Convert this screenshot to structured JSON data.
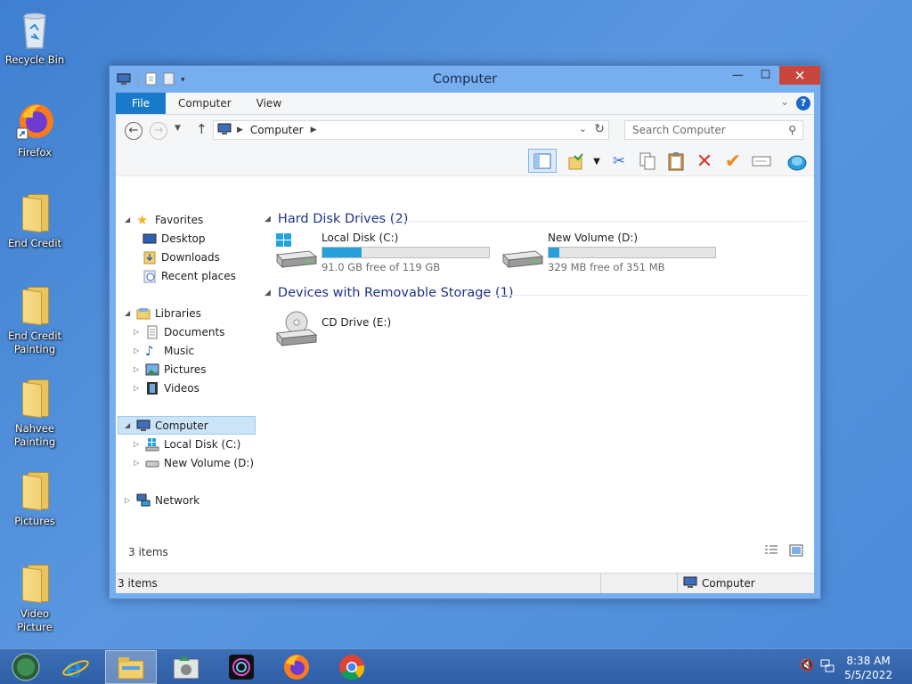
{
  "desktop": {
    "icons": [
      {
        "label": "Recycle Bin",
        "icon": "recycle-bin-icon"
      },
      {
        "label": "Firefox",
        "icon": "firefox-icon"
      },
      {
        "label": "End Credit",
        "icon": "folder-icon"
      },
      {
        "label": "End Credit Painting",
        "icon": "folder-icon"
      },
      {
        "label": "Nahvee Painting",
        "icon": "folder-icon"
      },
      {
        "label": "Pictures",
        "icon": "folder-icon"
      },
      {
        "label": "Video Picture",
        "icon": "folder-icon"
      }
    ]
  },
  "window": {
    "title": "Computer",
    "ribbon_tabs": [
      "File",
      "Computer",
      "View"
    ],
    "help": "?",
    "address": {
      "location": "Computer"
    },
    "search": {
      "placeholder": "Search Computer"
    },
    "nav_pane": {
      "favorites": {
        "label": "Favorites",
        "items": [
          "Desktop",
          "Downloads",
          "Recent places"
        ]
      },
      "libraries": {
        "label": "Libraries",
        "items": [
          "Documents",
          "Music",
          "Pictures",
          "Videos"
        ]
      },
      "computer": {
        "label": "Computer",
        "items": [
          "Local Disk (C:)",
          "New Volume (D:)"
        ]
      },
      "network": {
        "label": "Network"
      }
    },
    "groups": {
      "hard_disks": {
        "title": "Hard Disk Drives (2)",
        "drives": [
          {
            "name": "Local Disk (C:)",
            "free_text": "91.0 GB free of 119 GB",
            "used_fraction": 0.235
          },
          {
            "name": "New Volume (D:)",
            "free_text": "329 MB free of 351 MB",
            "used_fraction": 0.063
          }
        ]
      },
      "removable": {
        "title": "Devices with Removable Storage (1)",
        "drives": [
          {
            "name": "CD Drive (E:)"
          }
        ]
      }
    },
    "item_count": "3 items",
    "status": {
      "count": "3 items",
      "location": "Computer"
    }
  },
  "taskbar": {
    "clock": {
      "time": "8:38 AM",
      "date": "5/5/2022"
    }
  },
  "colors": {
    "accent": "#1979ca",
    "drive_fill": "#26a0da",
    "close": "#c9463d"
  }
}
